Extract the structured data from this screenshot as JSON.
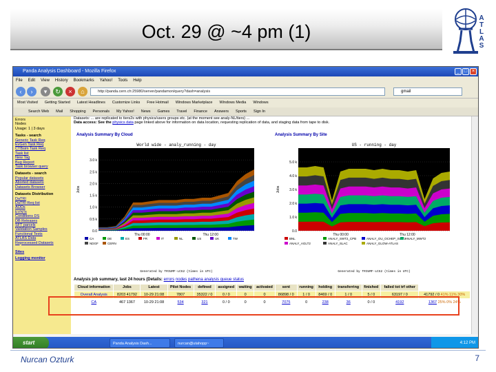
{
  "slide": {
    "title": "Oct. 29 @ ~4 pm (1)",
    "logo_letters": [
      "A",
      "T",
      "L",
      "A",
      "S"
    ],
    "author": "Nurcan Ozturk",
    "page_number": "7"
  },
  "browser": {
    "window_title": "Panda Analysis Dashboard - Mozilla Firefox",
    "menu": [
      "File",
      "Edit",
      "View",
      "History",
      "Bookmarks",
      "Yahoo!",
      "Tools",
      "Help"
    ],
    "url": "http://panda.cern.ch:25980/server/pandamon/query?dash=analysis",
    "search_value": "gmail",
    "bookmarks": [
      "Most Visited",
      "Getting Started",
      "Latest Headlines",
      "Customize Links",
      "Free Hotmail",
      "Windows Marketplace",
      "Windows Media",
      "Windows"
    ],
    "toolbar2": [
      "Search Web",
      "Mail",
      "Shopping",
      "Personals",
      "My Yahoo!",
      "News",
      "Games",
      "Travel",
      "Finance",
      "Answers",
      "Sports",
      "Sign In"
    ]
  },
  "sidebar": {
    "top": [
      "Errors",
      "Nodes",
      "Usage: 1 | 3 days"
    ],
    "groups": [
      {
        "head": "Tasks - search",
        "items": [
          "Generic Task Req",
          "EvGen Task Req",
          "CTBsim Task Req",
          "Task list",
          "New Tag",
          "Bug Report",
          "Task browser query"
        ]
      },
      {
        "head": "Datasets - search",
        "items": [
          "Popular datasets",
          "Aborted datasets",
          "Datasets Browser"
        ]
      },
      {
        "head": "Datasets Distribution",
        "items": [
          "DaTRI",
          "DaTRI Req list",
          "AODs",
          "EVNTs",
          "Conditions DS",
          "DB Releases",
          "SFT parcels",
          "Validation Samples",
          "Functional Tests",
          "ATLAS Data",
          "Reprocessed Datasets"
        ]
      },
      {
        "head": "",
        "items": [
          "Sites",
          "Logging monitor"
        ]
      }
    ]
  },
  "main": {
    "intro1": "Datasets: ... are replicated to tiers2s with physics/users groups etc. (at the moment see analy-NL/tiers) ...",
    "intro2_prefix": "Data access: See the",
    "intro2_link": "physics data",
    "intro2_suffix": "page linked above for information on data location, requesting replication of data, and staging data from tape to disk.",
    "summary_title": "Analysis job summary, last 24 hours (Details:",
    "summary_links": [
      "errors",
      "nodes",
      "pathena analysis queue status"
    ]
  },
  "chart_data": [
    {
      "type": "area",
      "title": "Analysis Summary By Cloud",
      "inner_title": "World wide - analy_running - day",
      "ylabel": "Jobs",
      "x": [
        "Thu 00:00",
        "Thu 12:00"
      ],
      "ylim": [
        0,
        3.5
      ],
      "yticks": [
        "0.0",
        "0.5 k",
        "1.0 k",
        "1.5 k",
        "2.0 k",
        "2.5 k",
        "3.0 k"
      ],
      "legend": [
        "CA",
        "DE",
        "ES",
        "FR",
        "IT",
        "NL",
        "US",
        "UK",
        "TW",
        "NDGF",
        "CERN"
      ],
      "colors": [
        "#0000aa",
        "#009900",
        "#00aaaa",
        "#cc0000",
        "#cc00cc",
        "#999900",
        "#005500",
        "#6600cc",
        "#0088ff",
        "#444444",
        "#aa5500"
      ],
      "series_stack_total": [
        0.15,
        0.15,
        0.2,
        0.6,
        1.2,
        1.2,
        1.25,
        1.3,
        1.3,
        1.3,
        1.35,
        1.35,
        1.4,
        1.4,
        1.5,
        1.6,
        2.1,
        2.4,
        2.6
      ],
      "footer": "Generated by TRIUMF-LCG2 (times in UTC)"
    },
    {
      "type": "area",
      "title": "Analysis Summary By Site",
      "inner_title": "US - running - day",
      "ylabel": "Jobs",
      "x": [
        "Thu 00:00",
        "Thu 12:00"
      ],
      "ylim": [
        0,
        6.0
      ],
      "yticks": [
        "0.0",
        "1.0 k",
        "2.0 k",
        "3.0 k",
        "4.0 k",
        "5.0 k"
      ],
      "legend": [
        "BNL",
        "ANALY_SWT2_CPB",
        "ANALY_OU_OCHEP_SWT2",
        "ANALY_MWT2",
        "ANALY_AGLT2",
        "ANALY_SLAC",
        "ANALY_GLOW-ATLAS"
      ],
      "colors": [
        "#cc0000",
        "#009900",
        "#0000cc",
        "#00aa66",
        "#cc00cc",
        "#333333",
        "#aaaa00"
      ],
      "series_stack_total": [
        4.6,
        4.6,
        4.7,
        4.6,
        2.2,
        4.3,
        4.5,
        4.5,
        4.5,
        4.4,
        4.5,
        4.4,
        4.4,
        4.3,
        4.4,
        2.3,
        3.8,
        4.2,
        4.3
      ],
      "footer": "Generated by TRIUMF-LCG2 (times in UTC)"
    }
  ],
  "jobs_table": {
    "headers": [
      "Cloud information",
      "Jobs",
      "Latest",
      "Pilot Nodes",
      "defined",
      "assigned",
      "waiting",
      "activated",
      "sent",
      "running",
      "holding",
      "transferring",
      "finished",
      "failed tot trf other"
    ],
    "rows": [
      {
        "cloud": "Overall Analysis",
        "jobs": "8203",
        "jobs2": "41792",
        "latest": "10-29 21:08",
        "pilots": "7807",
        "nodes": "35322 / 0",
        "defined": "0 / 0",
        "assigned": "0",
        "waiting": "0",
        "activated": "86898 / 0",
        "sent": "1 / 0",
        "running": "8469 / 0",
        "holding": "1 / 0",
        "transferring": "5 / 0",
        "finished": "63197 / 0",
        "failed": "41792 / 0",
        "pct": "41%  11%  30%"
      },
      {
        "cloud": "CA",
        "jobs": "467",
        "jobs2": "1367",
        "latest": "10-29 21:08",
        "pilots": "534",
        "nodes": "321",
        "defined": "0 / 0",
        "assigned": "0",
        "waiting": "0",
        "activated": "7075",
        "sent": "0",
        "running": "238",
        "holding": "36",
        "transferring": "0 / 0",
        "finished": "4192",
        "failed": "1367",
        "pct": "25%  0%  24%"
      }
    ]
  },
  "taskbar": {
    "start": "start",
    "tasks": [
      "Panda Analysis Dash...",
      "nurcan@utahopp~"
    ],
    "clock": "4:12 PM"
  }
}
